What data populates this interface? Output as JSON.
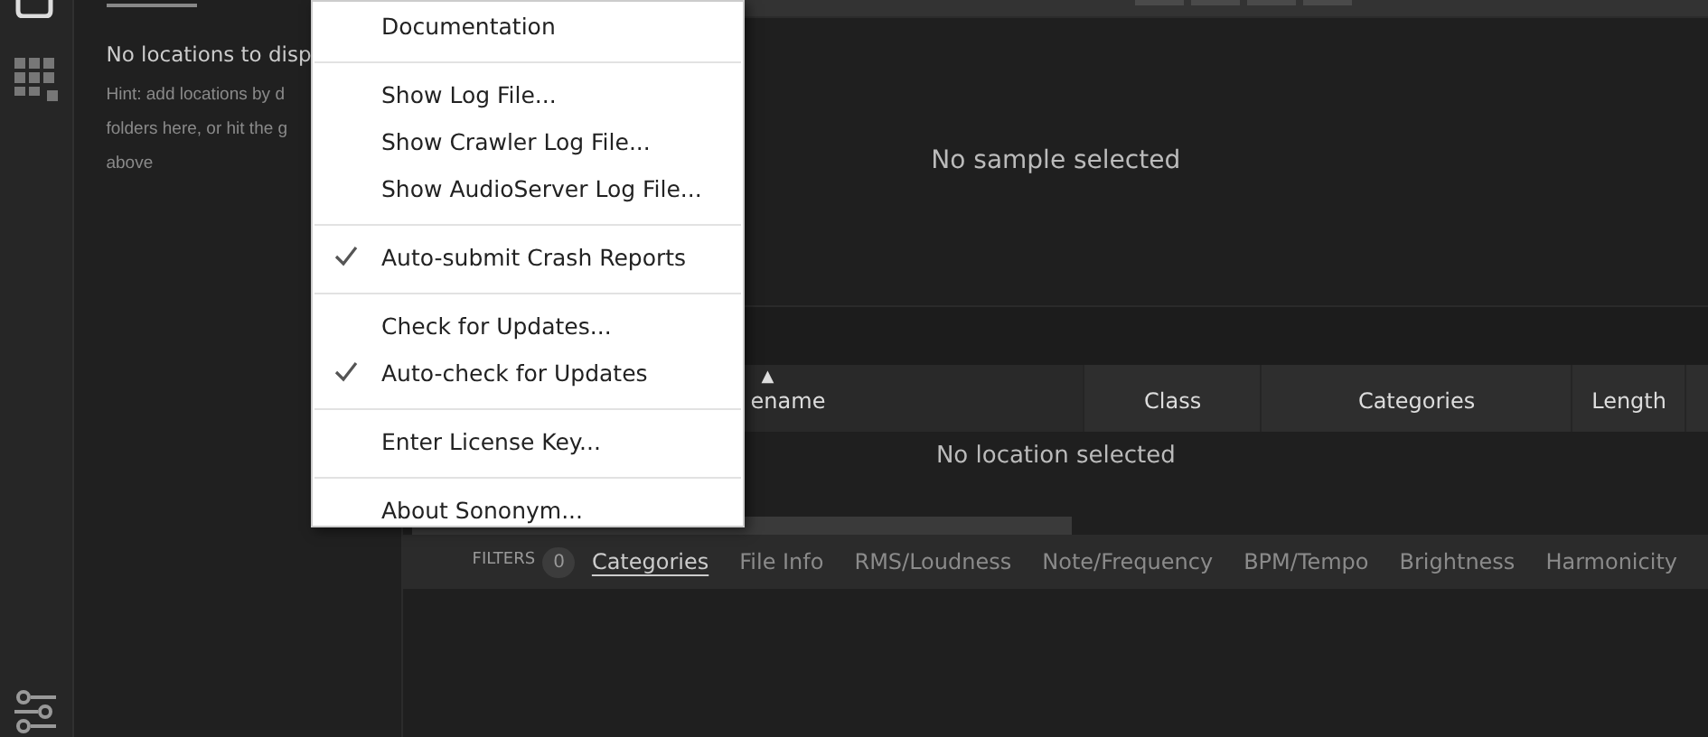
{
  "locations_panel": {
    "title": "No locations to disp",
    "hint_lines": [
      "Hint: add locations by d",
      "folders here, or hit the g",
      "above"
    ]
  },
  "sample_view": {
    "message": "No sample selected"
  },
  "table": {
    "columns": [
      {
        "label": "ename",
        "sorted": true
      },
      {
        "label": "Class",
        "sorted": false
      },
      {
        "label": "Categories",
        "sorted": false
      },
      {
        "label": "Length",
        "sorted": false
      }
    ],
    "sort_indicator": "▲",
    "empty_message": "No location selected"
  },
  "filters": {
    "label": "FILTERS",
    "count": "0",
    "tabs": [
      {
        "label": "Categories",
        "selected": true
      },
      {
        "label": "File Info",
        "selected": false
      },
      {
        "label": "RMS/Loudness",
        "selected": false
      },
      {
        "label": "Note/Frequency",
        "selected": false
      },
      {
        "label": "BPM/Tempo",
        "selected": false
      },
      {
        "label": "Brightness",
        "selected": false
      },
      {
        "label": "Harmonicity",
        "selected": false
      }
    ]
  },
  "menu": {
    "items": [
      {
        "kind": "item",
        "label": "Documentation",
        "checked": false
      },
      {
        "kind": "separator"
      },
      {
        "kind": "item",
        "label": "Show Log File...",
        "checked": false
      },
      {
        "kind": "item",
        "label": "Show Crawler Log File...",
        "checked": false
      },
      {
        "kind": "item",
        "label": "Show AudioServer Log File...",
        "checked": false
      },
      {
        "kind": "separator"
      },
      {
        "kind": "item",
        "label": "Auto-submit Crash Reports",
        "checked": true
      },
      {
        "kind": "separator"
      },
      {
        "kind": "item",
        "label": "Check for Updates...",
        "checked": false
      },
      {
        "kind": "item",
        "label": "Auto-check for Updates",
        "checked": true
      },
      {
        "kind": "separator"
      },
      {
        "kind": "item",
        "label": "Enter License Key...",
        "checked": false
      },
      {
        "kind": "separator"
      },
      {
        "kind": "item",
        "label": "About Sononym...",
        "checked": false
      }
    ]
  }
}
